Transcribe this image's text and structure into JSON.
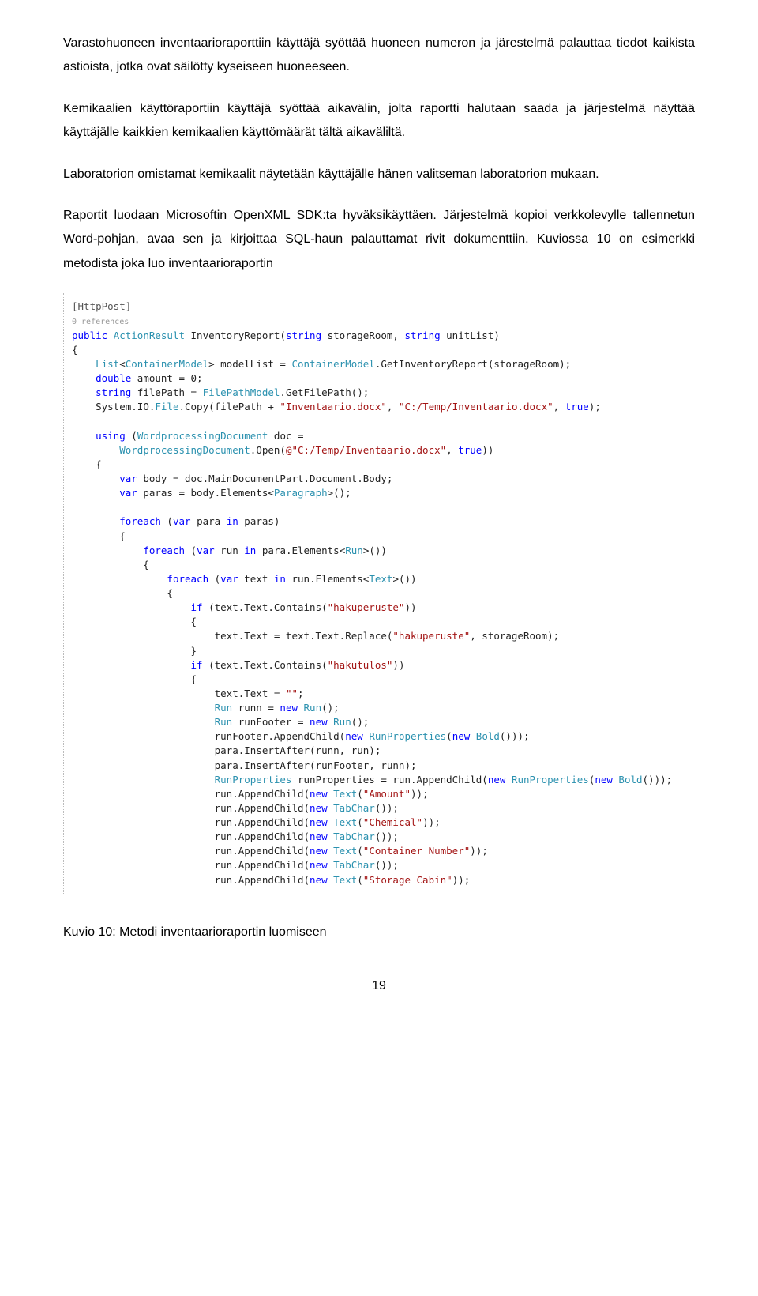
{
  "paragraphs": {
    "p1": "Varastohuoneen inventaarioraporttiin käyttäjä syöttää huoneen numeron ja järestelmä palauttaa tiedot kaikista astioista, jotka ovat säilötty kyseiseen huoneeseen.",
    "p2": "Kemikaalien käyttöraportiin käyttäjä syöttää aikavälin, jolta raportti halutaan saada ja järjestelmä näyttää käyttäjälle kaikkien kemikaalien käyttömäärät tältä aikaväliltä.",
    "p3": "Laboratorion omistamat kemikaalit näytetään käyttäjälle hänen valitseman laboratorion mukaan.",
    "p4": "Raportit luodaan Microsoftin OpenXML SDK:ta hyväksikäyttäen. Järjestelmä kopioi verkkolevylle tallennetun Word-pohjan, avaa sen ja kirjoittaa SQL-haun palauttamat rivit dokumenttiin. Kuviossa 10 on esimerkki metodista joka luo inventaarioraportin"
  },
  "code": {
    "attribute": "[HttpPost]",
    "references": "0 references",
    "sig_kw1": "public",
    "sig_type1": "ActionResult",
    "sig_name": "InventoryReport(",
    "sig_kw2": "string",
    "sig_p1": " storageRoom, ",
    "sig_kw3": "string",
    "sig_p2": " unitList)",
    "l1a": "List",
    "l1b": "<",
    "l1c": "ContainerModel",
    "l1d": "> modelList = ",
    "l1e": "ContainerModel",
    "l1f": ".GetInventoryReport(storageRoom);",
    "l2a": "double",
    "l2b": " amount = 0;",
    "l3a": "string",
    "l3b": " filePath = ",
    "l3c": "FilePathModel",
    "l3d": ".GetFilePath();",
    "l4a": "System.IO.",
    "l4b": "File",
    "l4c": ".Copy(filePath + ",
    "l4d": "\"Inventaario.docx\"",
    "l4e": ", ",
    "l4f": "\"C:/Temp/Inventaario.docx\"",
    "l4g": ", ",
    "l4h": "true",
    "l4i": ");",
    "l5a": "using",
    "l5b": " (",
    "l5c": "WordprocessingDocument",
    "l5d": " doc =",
    "l6a": "WordprocessingDocument",
    "l6b": ".Open(",
    "l6c": "@\"C:/Temp/Inventaario.docx\"",
    "l6d": ", ",
    "l6e": "true",
    "l6f": "))",
    "l7a": "var",
    "l7b": " body = doc.MainDocumentPart.Document.Body;",
    "l8a": "var",
    "l8b": " paras = body.Elements<",
    "l8c": "Paragraph",
    "l8d": ">();",
    "l9a": "foreach",
    "l9b": " (",
    "l9c": "var",
    "l9d": " para ",
    "l9e": "in",
    "l9f": " paras)",
    "l10a": "foreach",
    "l10b": " (",
    "l10c": "var",
    "l10d": " run ",
    "l10e": "in",
    "l10f": " para.Elements<",
    "l10g": "Run",
    "l10h": ">())",
    "l11a": "foreach",
    "l11b": " (",
    "l11c": "var",
    "l11d": " text ",
    "l11e": "in",
    "l11f": " run.Elements<",
    "l11g": "Text",
    "l11h": ">())",
    "l12a": "if",
    "l12b": " (text.Text.Contains(",
    "l12c": "\"hakuperuste\"",
    "l12d": "))",
    "l13a": "text.Text = text.Text.Replace(",
    "l13b": "\"hakuperuste\"",
    "l13c": ", storageRoom);",
    "l14a": "if",
    "l14b": " (text.Text.Contains(",
    "l14c": "\"hakutulos\"",
    "l14d": "))",
    "l15a": "text.Text = ",
    "l15b": "\"\"",
    "l15c": ";",
    "l16a": "Run",
    "l16b": " runn = ",
    "l16c": "new",
    "l16d": " ",
    "l16e": "Run",
    "l16f": "();",
    "l17a": "Run",
    "l17b": " runFooter = ",
    "l17c": "new",
    "l17d": " ",
    "l17e": "Run",
    "l17f": "();",
    "l18a": "runFooter.AppendChild(",
    "l18b": "new",
    "l18c": " ",
    "l18d": "RunProperties",
    "l18e": "(",
    "l18f": "new",
    "l18g": " ",
    "l18h": "Bold",
    "l18i": "()));",
    "l19": "para.InsertAfter(runn, run);",
    "l20": "para.InsertAfter(runFooter, runn);",
    "l21a": "RunProperties",
    "l21b": " runProperties = run.AppendChild(",
    "l21c": "new",
    "l21d": " ",
    "l21e": "RunProperties",
    "l21f": "(",
    "l21g": "new",
    "l21h": " ",
    "l21i": "Bold",
    "l21j": "()));",
    "l22a": "run.AppendChild(",
    "l22b": "new",
    "l22c": " ",
    "l22d": "Text",
    "l22e": "(",
    "l22f": "\"Amount\"",
    "l22g": "));",
    "l23a": "run.AppendChild(",
    "l23b": "new",
    "l23c": " ",
    "l23d": "TabChar",
    "l23e": "());",
    "l24a": "run.AppendChild(",
    "l24b": "new",
    "l24c": " ",
    "l24d": "Text",
    "l24e": "(",
    "l24f": "\"Chemical\"",
    "l24g": "));",
    "l25a": "run.AppendChild(",
    "l25b": "new",
    "l25c": " ",
    "l25d": "TabChar",
    "l25e": "());",
    "l26a": "run.AppendChild(",
    "l26b": "new",
    "l26c": " ",
    "l26d": "Text",
    "l26e": "(",
    "l26f": "\"Container Number\"",
    "l26g": "));",
    "l27a": "run.AppendChild(",
    "l27b": "new",
    "l27c": " ",
    "l27d": "TabChar",
    "l27e": "());",
    "l28a": "run.AppendChild(",
    "l28b": "new",
    "l28c": " ",
    "l28d": "Text",
    "l28e": "(",
    "l28f": "\"Storage Cabin\"",
    "l28g": "));"
  },
  "caption": "Kuvio 10: Metodi inventaarioraportin luomiseen",
  "pageNumber": "19"
}
